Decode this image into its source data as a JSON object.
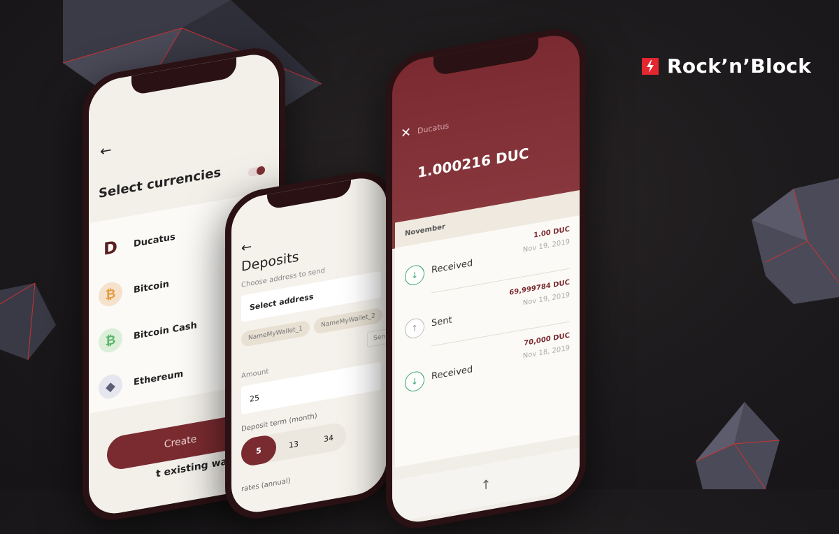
{
  "brand": {
    "name": "Rock’n’Block",
    "color": "#e3262f"
  },
  "currencies_screen": {
    "title": "Select currencies",
    "items": [
      {
        "name": "Ducatus",
        "icon": "ducatus-lion-icon",
        "symbol": "D"
      },
      {
        "name": "Bitcoin",
        "icon": "bitcoin-icon",
        "symbol": "₿"
      },
      {
        "name": "Bitcoin Cash",
        "icon": "bitcoin-cash-icon",
        "symbol": "₿"
      },
      {
        "name": "Ethereum",
        "icon": "ethereum-icon",
        "symbol": "◆"
      }
    ],
    "create_label": "Create",
    "existing_label": "t existing wallet"
  },
  "deposits_screen": {
    "title": "Deposits",
    "address_hint": "Choose address to send",
    "select_label": "Select address",
    "wallets": [
      "NameMyWallet_1",
      "NameMyWallet_2"
    ],
    "send_partial": "Sen",
    "amount_label": "Amount",
    "amount_value": "25",
    "term_label": "Deposit term (month)",
    "terms": [
      "5",
      "13",
      "34"
    ],
    "selected_term": "5",
    "rates_label": "rates (annual)"
  },
  "wallet_screen": {
    "coin": "Ducatus",
    "balance": "1.000216 DUC",
    "month": "November",
    "transactions": [
      {
        "type": "Received",
        "amount": "1.00 DUC",
        "date": "Nov 19, 2019"
      },
      {
        "type": "Sent",
        "amount": "69,999784 DUC",
        "date": "Nov 19, 2019"
      },
      {
        "type": "Received",
        "amount": "70,000 DUC",
        "date": "Nov 18, 2019"
      }
    ]
  }
}
